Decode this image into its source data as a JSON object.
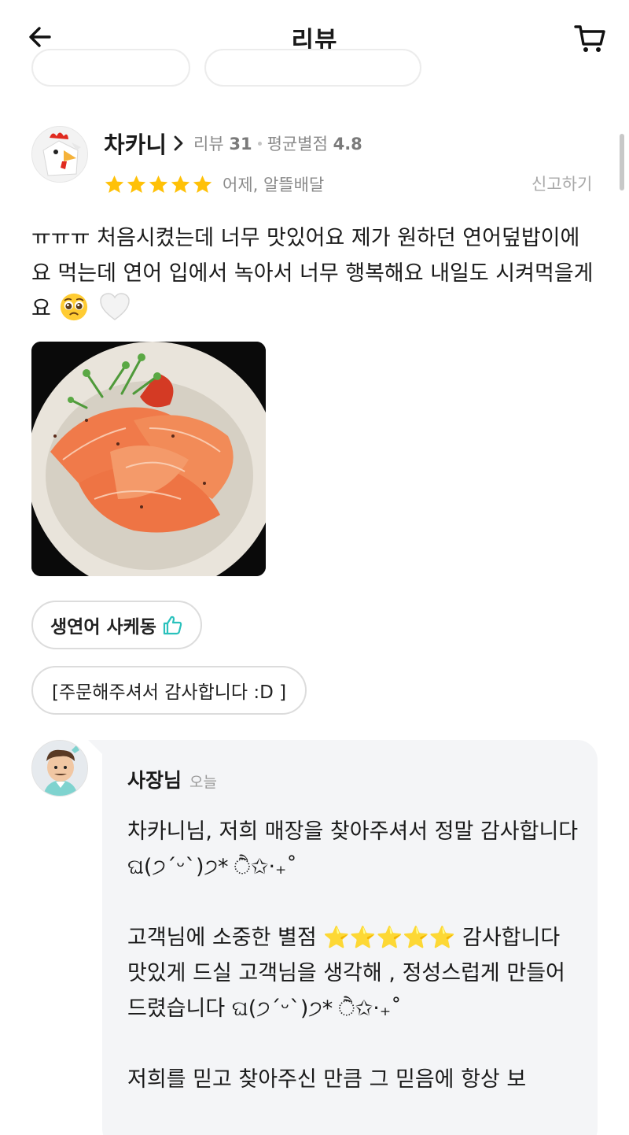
{
  "header": {
    "title": "리뷰"
  },
  "review": {
    "user_name": "차카니",
    "review_count_label": "리뷰",
    "review_count": "31",
    "avg_rating_label": "평균별점",
    "avg_rating": "4.8",
    "rating": 5,
    "date_delivery": "어제, 알뜰배달",
    "report_label": "신고하기",
    "text": "ㅠㅠㅠ 처음시켰는데 너무 맛있어요 제가 원하던 연어덮밥이에요 먹는데 연어 입에서 녹아서 너무 행복해요 내일도 시켜먹을게요",
    "menu_item": "생연어 사케동",
    "tag": "[주문해주셔서 감사합니다 :D ]"
  },
  "reply": {
    "name": "사장님",
    "date": "오늘",
    "text": "차카니님, 저희 매장을 찾아주셔서 정말 감사합니다 ଘ(੭ˊᵕˋ)੭* ੈ✩‧₊˚\n\n고객님에 소중한 별점 ⭐⭐⭐⭐⭐ 감사합니다\n맛있게 드실 고객님을 생각해 , 정성스럽게 만들어 드렸습니다 ଘ(੭ˊᵕˋ)੭* ੈ✩‧₊˚\n\n저희를 믿고 찾아주신 만큼 그 믿음에 항상 보"
  },
  "colors": {
    "star": "#FFC107",
    "chip_border": "#dcdcdc",
    "thumb": "#2ac1bc",
    "bubble": "#f4f5f7"
  },
  "icons": [
    "back-arrow-icon",
    "cart-icon",
    "chevron-right-icon",
    "star-icon",
    "thumbs-up-icon",
    "pleading-face-emoji",
    "white-heart-emoji"
  ]
}
